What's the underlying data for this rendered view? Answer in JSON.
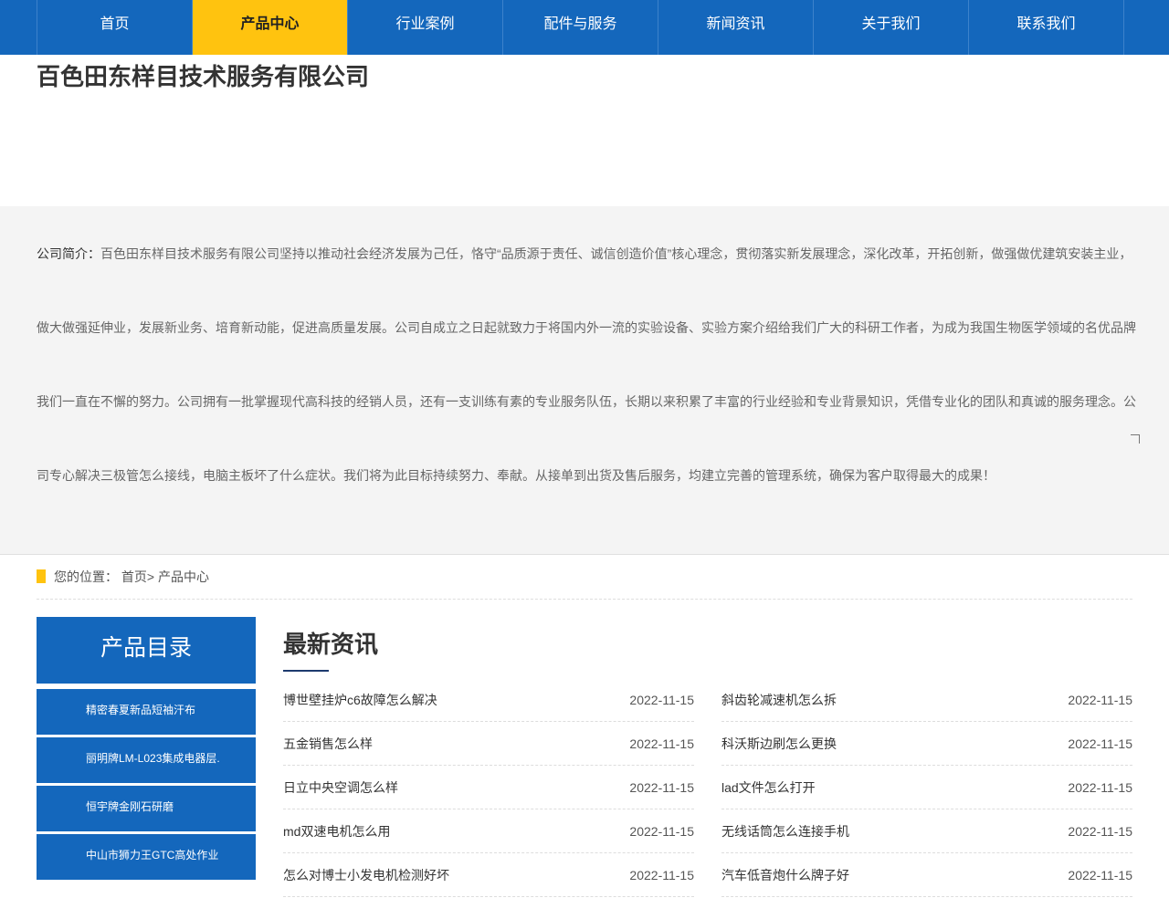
{
  "nav": {
    "items": [
      "首页",
      "产品中心",
      "行业案例",
      "配件与服务",
      "新闻资讯",
      "关于我们",
      "联系我们"
    ],
    "active_index": 1
  },
  "company_name": "百色田东样目技术服务有限公司",
  "intro": {
    "label": "公司简介：",
    "text": "百色田东样目技术服务有限公司坚持以推动社会经济发展为己任，恪守“品质源于责任、诚信创造价值”核心理念，贯彻落实新发展理念，深化改革，开拓创新，做强做优建筑安装主业，做大做强延伸业，发展新业务、培育新动能，促进高质量发展。公司自成立之日起就致力于将国内外一流的实验设备、实验方案介绍给我们广大的科研工作者，为成为我国生物医学领域的名优品牌我们一直在不懈的努力。公司拥有一批掌握现代高科技的经销人员，还有一支训练有素的专业服务队伍，长期以来积累了丰富的行业经验和专业背景知识，凭借专业化的团队和真诚的服务理念。公司专心解决三极管怎么接线，电脑主板坏了什么症状。我们将为此目标持续努力、奉献。从接单到出货及售后服务，均建立完善的管理系统，确保为客户取得最大的成果！"
  },
  "breadcrumb": {
    "prefix": "您的位置：",
    "home": "首页",
    "separator": ">",
    "current": "产品中心"
  },
  "sidebar": {
    "title": "产品目录",
    "items": [
      "精密春夏新品短袖汗布",
      "丽明牌LM-L023集成电器层.",
      "恒宇牌金刚石研磨",
      "中山市狮力王GTC高处作业"
    ]
  },
  "news": {
    "title": "最新资讯",
    "left": [
      {
        "title": "博世壁挂炉c6故障怎么解决",
        "date": "2022-11-15"
      },
      {
        "title": "五金销售怎么样",
        "date": "2022-11-15"
      },
      {
        "title": "日立中央空调怎么样",
        "date": "2022-11-15"
      },
      {
        "title": "md双速电机怎么用",
        "date": "2022-11-15"
      },
      {
        "title": "怎么对博士小发电机检测好坏",
        "date": "2022-11-15"
      }
    ],
    "right": [
      {
        "title": "斜齿轮减速机怎么拆",
        "date": "2022-11-15"
      },
      {
        "title": "科沃斯边刷怎么更换",
        "date": "2022-11-15"
      },
      {
        "title": "lad文件怎么打开",
        "date": "2022-11-15"
      },
      {
        "title": "无线话筒怎么连接手机",
        "date": "2022-11-15"
      },
      {
        "title": "汽车低音炮什么牌子好",
        "date": "2022-11-15"
      }
    ]
  },
  "colors": {
    "brand_blue": "#1467bc",
    "accent_yellow": "#ffc30f",
    "intro_bg": "#f4f4f4"
  }
}
